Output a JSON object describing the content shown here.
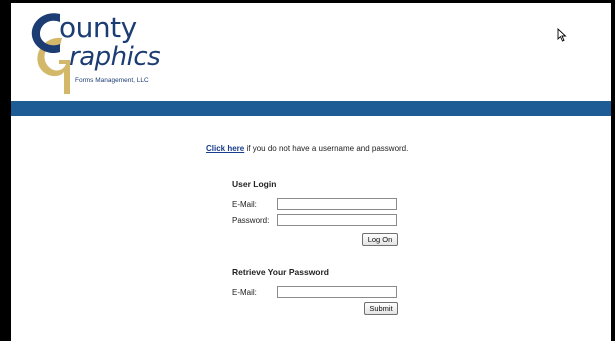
{
  "brand": {
    "name_part1": "ounty",
    "name_part2": "raphics",
    "subtitle": "Forms Management, LLC",
    "primary_color": "#1c3d73",
    "accent_color": "#d4b86a"
  },
  "band": {
    "color": "#1e5c96"
  },
  "intro": {
    "link_text": "Click here",
    "text": " if you do not have a username and password."
  },
  "login": {
    "title": "User Login",
    "email_label": "E-Mail:",
    "email_value": "",
    "password_label": "Password:",
    "password_value": "",
    "button_label": "Log On"
  },
  "retrieve": {
    "title": "Retrieve Your Password",
    "email_label": "E-Mail:",
    "email_value": "",
    "button_label": "Submit"
  },
  "icons": {
    "cursor": "mouse-pointer-icon"
  }
}
